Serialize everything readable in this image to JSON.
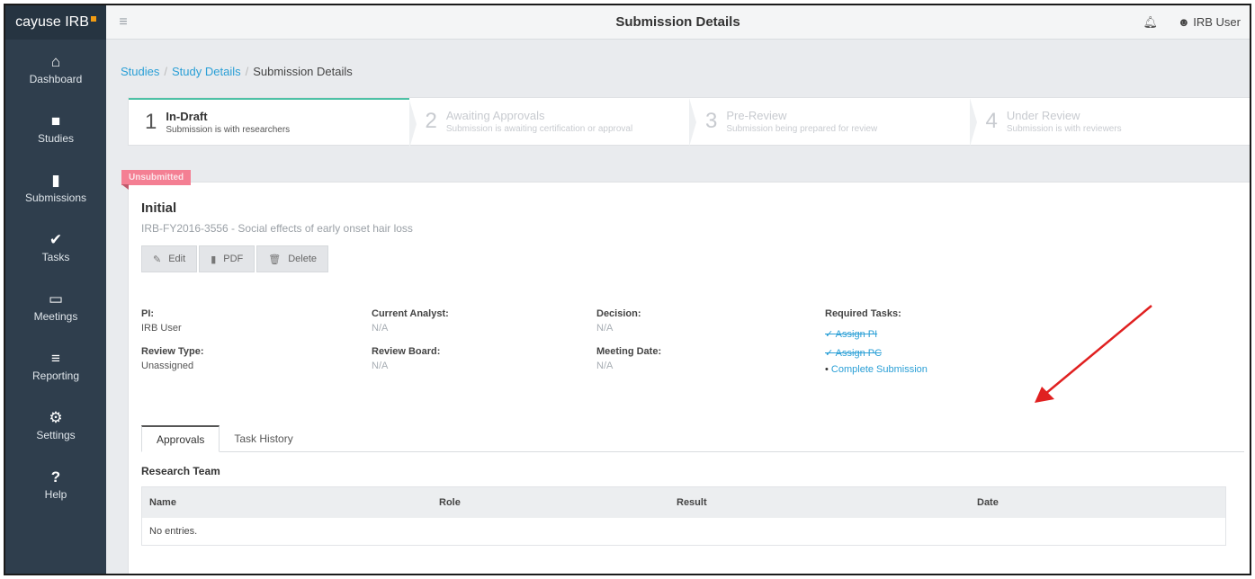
{
  "app": {
    "brand": "cayuse IRB"
  },
  "header": {
    "title": "Submission Details",
    "user": "IRB User"
  },
  "sidebar": {
    "items": [
      {
        "icon": "🏠",
        "label": "Dashboard"
      },
      {
        "icon": "■",
        "label": "Studies"
      },
      {
        "icon": "▮",
        "label": "Submissions"
      },
      {
        "icon": "✔",
        "label": "Tasks"
      },
      {
        "icon": "▭",
        "label": "Meetings"
      },
      {
        "icon": "≡",
        "label": "Reporting"
      },
      {
        "icon": "⚙",
        "label": "Settings"
      },
      {
        "icon": "?",
        "label": "Help"
      }
    ]
  },
  "breadcrumb": {
    "items": [
      "Studies",
      "Study Details",
      "Submission Details"
    ]
  },
  "stepper": {
    "steps": [
      {
        "num": "1",
        "label": "In-Draft",
        "sub": "Submission is with researchers"
      },
      {
        "num": "2",
        "label": "Awaiting Approvals",
        "sub": "Submission is awaiting certification or approval"
      },
      {
        "num": "3",
        "label": "Pre-Review",
        "sub": "Submission being prepared for review"
      },
      {
        "num": "4",
        "label": "Under Review",
        "sub": "Submission is with reviewers"
      }
    ]
  },
  "submission": {
    "badge": "Unsubmitted",
    "title": "Initial",
    "subtitle": "IRB-FY2016-3556 - Social effects of early onset hair loss",
    "buttons": {
      "edit": "Edit",
      "pdf": "PDF",
      "delete": "Delete"
    },
    "fields": {
      "pi_label": "PI:",
      "pi_value": "IRB User",
      "review_type_label": "Review Type:",
      "review_type_value": "Unassigned",
      "analyst_label": "Current Analyst:",
      "analyst_value": "N/A",
      "board_label": "Review Board:",
      "board_value": "N/A",
      "decision_label": "Decision:",
      "decision_value": "N/A",
      "meeting_label": "Meeting Date:",
      "meeting_value": "N/A",
      "tasks_label": "Required Tasks:"
    },
    "tasks": [
      {
        "label": "Assign PI",
        "done": true
      },
      {
        "label": "Assign PC",
        "done": true
      },
      {
        "label": "Complete Submission",
        "done": false
      }
    ]
  },
  "tabs": {
    "approvals": "Approvals",
    "history": "Task History"
  },
  "team": {
    "heading": "Research Team",
    "columns": [
      "Name",
      "Role",
      "Result",
      "Date"
    ],
    "empty": "No entries."
  },
  "colors": {
    "sidebar": "#2f3e4d",
    "accent": "#2a9fd6",
    "badge": "#f47f93",
    "step_active": "#4fc1a6",
    "arrow": "#e02020"
  }
}
